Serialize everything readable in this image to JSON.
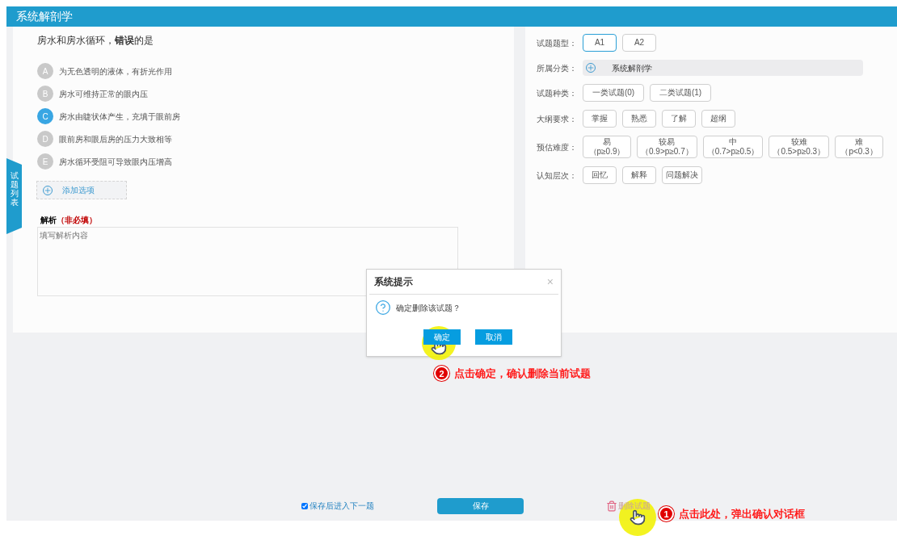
{
  "header": {
    "title": "系统解剖学"
  },
  "side_tab": {
    "label": "试题列表"
  },
  "question": {
    "stem": "房水和房水循环，**错误**的是",
    "add_option": "添加选项",
    "options": [
      {
        "letter": "A",
        "text": "为无色透明的液体，有折光作用",
        "selected": false
      },
      {
        "letter": "B",
        "text": "房水可维持正常的眼内压",
        "selected": false
      },
      {
        "letter": "C",
        "text": "房水由睫状体产生，充填于眼前房",
        "selected": true
      },
      {
        "letter": "D",
        "text": "眼前房和眼后房的压力大致相等",
        "selected": false
      },
      {
        "letter": "E",
        "text": "房水循环受阻可导致眼内压增高",
        "selected": false
      }
    ]
  },
  "analysis": {
    "label": "解析",
    "note": "（非必填）",
    "placeholder": "填写解析内容"
  },
  "properties": [
    {
      "kind": "buttons",
      "label": "试题题型：",
      "options": [
        {
          "text": "A1",
          "selected": true
        },
        {
          "text": "A2",
          "selected": false
        }
      ]
    },
    {
      "kind": "category",
      "label": "所属分类：",
      "value": "系统解剖学"
    },
    {
      "kind": "buttons",
      "label": "试题种类：",
      "options": [
        {
          "text": "一类试题(0)",
          "selected": false
        },
        {
          "text": "二类试题(1)",
          "selected": false
        }
      ]
    },
    {
      "kind": "buttons",
      "label": "大纲要求：",
      "options": [
        {
          "text": "掌握",
          "selected": false
        },
        {
          "text": "熟悉",
          "selected": false
        },
        {
          "text": "了解",
          "selected": false
        },
        {
          "text": "超纲",
          "selected": false
        }
      ]
    },
    {
      "kind": "buttons",
      "label": "预估难度：",
      "options": [
        {
          "text": "易",
          "sub": "（p≥0.9）",
          "selected": false
        },
        {
          "text": "较易",
          "sub": "（0.9>p≥0.7）",
          "selected": false
        },
        {
          "text": "中",
          "sub": "（0.7>p≥0.5）",
          "selected": false
        },
        {
          "text": "较难",
          "sub": "（0.5>p≥0.3）",
          "selected": false
        },
        {
          "text": "难",
          "sub": "（p<0.3）",
          "selected": false
        }
      ]
    },
    {
      "kind": "buttons",
      "label": "认知层次：",
      "options": [
        {
          "text": "回忆",
          "selected": false
        },
        {
          "text": "解释",
          "selected": false
        },
        {
          "text": "问题解决",
          "selected": false
        }
      ]
    }
  ],
  "dialog": {
    "title": "系统提示",
    "close": "×",
    "message": "确定删除该试题？",
    "buttons": [
      "确定",
      "取消"
    ]
  },
  "footer": {
    "next_checkbox": {
      "label": "保存后进入下一题",
      "checked": true
    },
    "save": "保存",
    "delete": "删除试题"
  },
  "annotations": [
    {
      "number": "2",
      "text": "点击确定，确认删除当前试题"
    },
    {
      "number": "1",
      "text": "点击此处，弹出确认对话框"
    }
  ]
}
